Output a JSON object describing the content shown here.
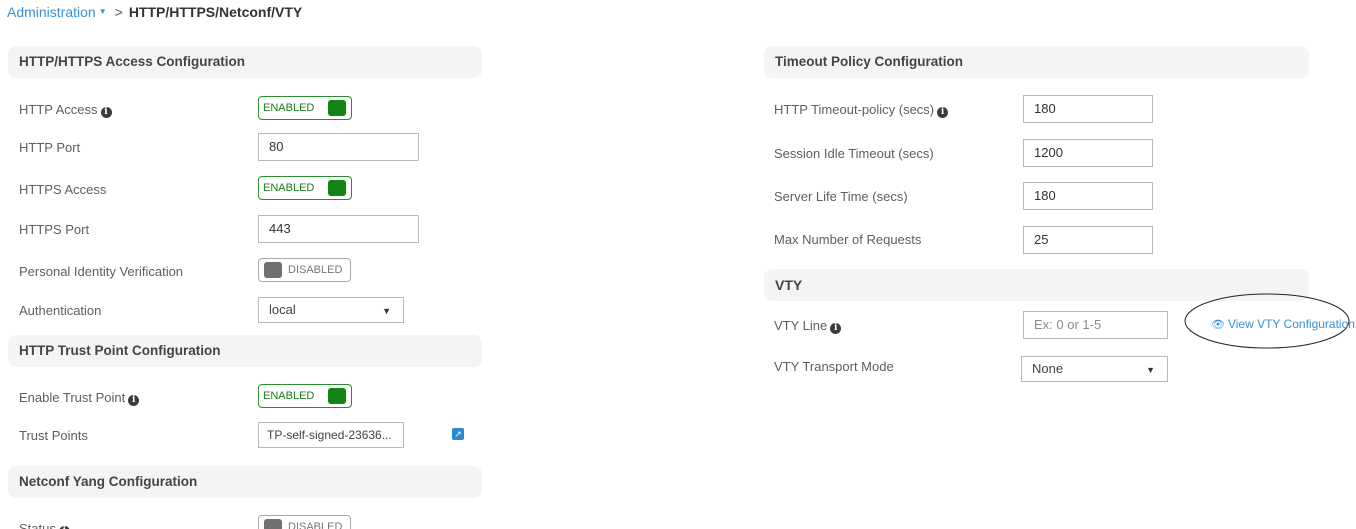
{
  "breadcrumb": {
    "parent": "Administration",
    "current": "HTTP/HTTPS/Netconf/VTY"
  },
  "http_access": {
    "title": "HTTP/HTTPS Access Configuration",
    "http_access_label": "HTTP Access",
    "http_access_state": "ENABLED",
    "http_port_label": "HTTP Port",
    "http_port_value": "80",
    "https_access_label": "HTTPS Access",
    "https_access_state": "ENABLED",
    "https_port_label": "HTTPS Port",
    "https_port_value": "443",
    "piv_label": "Personal Identity Verification",
    "piv_state": "DISABLED",
    "auth_label": "Authentication",
    "auth_value": "local"
  },
  "trust_point": {
    "title": "HTTP Trust Point Configuration",
    "enable_label": "Enable Trust Point",
    "enable_state": "ENABLED",
    "points_label": "Trust Points",
    "points_value": "TP-self-signed-23636..."
  },
  "netconf": {
    "title": "Netconf Yang Configuration",
    "status_label": "Status",
    "status_state": "DISABLED"
  },
  "timeout": {
    "title": "Timeout Policy Configuration",
    "http_timeout_label": "HTTP Timeout-policy (secs)",
    "http_timeout_value": "180",
    "idle_label": "Session Idle Timeout (secs)",
    "idle_value": "1200",
    "server_life_label": "Server Life Time (secs)",
    "server_life_value": "180",
    "max_req_label": "Max Number of Requests",
    "max_req_value": "25"
  },
  "vty": {
    "title": "VTY",
    "line_label": "VTY Line",
    "line_placeholder": "Ex: 0 or 1-5",
    "view_link": "View VTY Configuration",
    "transport_label": "VTY Transport Mode",
    "transport_value": "None"
  },
  "icons": {
    "info": "info-circle-icon",
    "edit": "external-edit-icon",
    "eye": "eye-icon",
    "dropdown": "caret-down-icon"
  },
  "colors": {
    "link": "#3a8fd6",
    "enabled": "#128512",
    "disabled": "#707070"
  }
}
